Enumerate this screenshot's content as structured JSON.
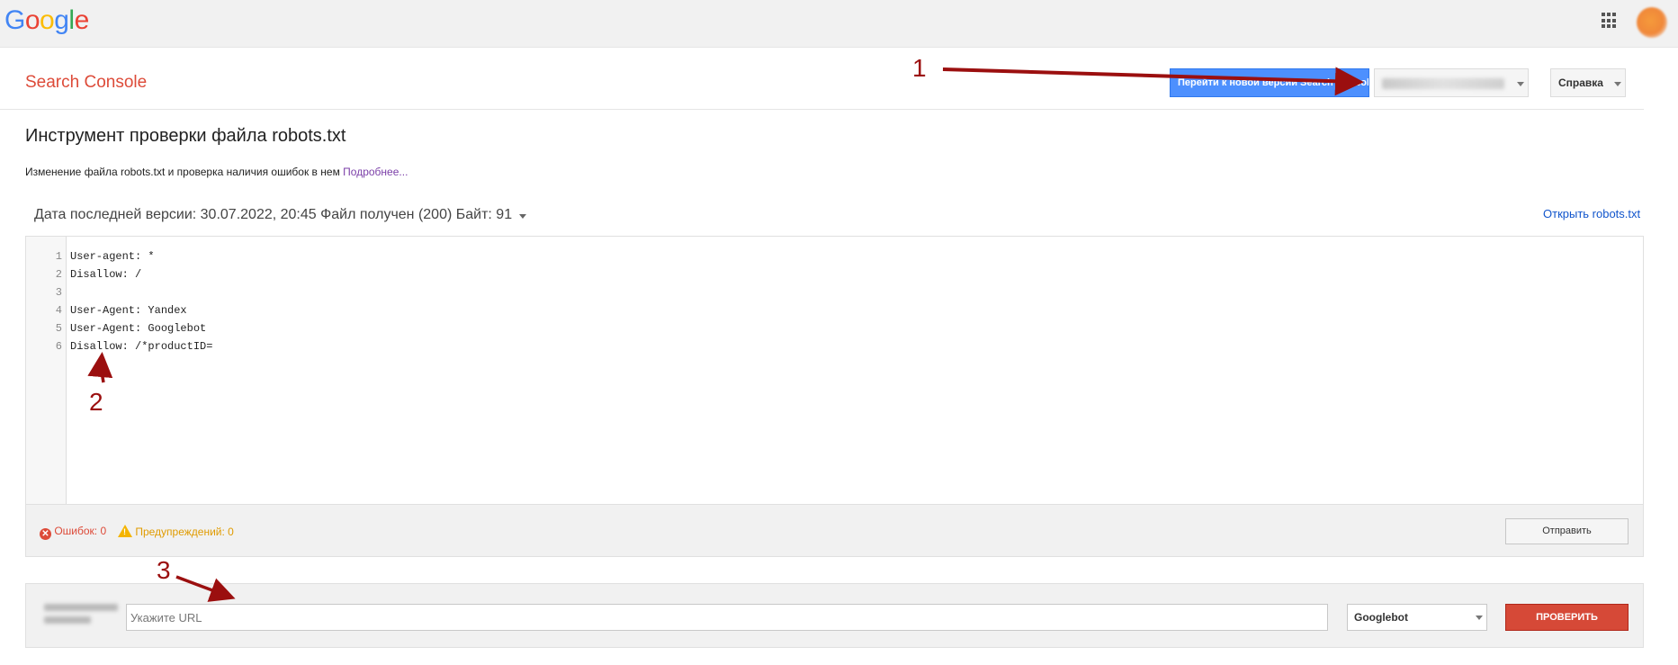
{
  "topbar": {
    "logo_letters": [
      {
        "ch": "G",
        "color": "#4285f4"
      },
      {
        "ch": "o",
        "color": "#ea4335"
      },
      {
        "ch": "o",
        "color": "#fbbc05"
      },
      {
        "ch": "g",
        "color": "#4285f4"
      },
      {
        "ch": "l",
        "color": "#34a853"
      },
      {
        "ch": "e",
        "color": "#ea4335"
      }
    ],
    "apps_icon": "apps-grid-icon",
    "avatar_color": "#f0883a"
  },
  "header": {
    "app_title": "Search Console",
    "new_version_button": "Перейти к новой версии Search Console",
    "property_select": "",
    "help_menu": "Справка"
  },
  "annotations": {
    "n1": "1",
    "n2": "2",
    "n3": "3",
    "color": "#9b0f0f"
  },
  "main": {
    "title": "Инструмент проверки файла robots.txt",
    "description": "Изменение файла robots.txt и проверка наличия ошибок в нем",
    "more_link": "Подробнее...",
    "version_info": "Дата последней версии: 30.07.2022, 20:45 Файл получен (200) Байт: 91",
    "open_link": "Открыть robots.txt"
  },
  "editor": {
    "lines": [
      {
        "num": "1",
        "text": "User-agent: *"
      },
      {
        "num": "2",
        "text": "Disallow: /"
      },
      {
        "num": "3",
        "text": ""
      },
      {
        "num": "4",
        "text": "User-Agent: Yandex"
      },
      {
        "num": "5",
        "text": "User-Agent: Googlebot"
      },
      {
        "num": "6",
        "text": "Disallow: /*productID="
      }
    ]
  },
  "status": {
    "errors": "Ошибок: 0",
    "warnings": "Предупреждений: 0",
    "submit_button": "Отправить",
    "error_color": "#dd4b39",
    "warning_color": "#e09b00"
  },
  "test": {
    "url_placeholder": "Укажите URL",
    "url_value": "",
    "bot_select": "Googlebot",
    "check_button": "ПРОВЕРИТЬ",
    "check_color": "#d64937"
  }
}
